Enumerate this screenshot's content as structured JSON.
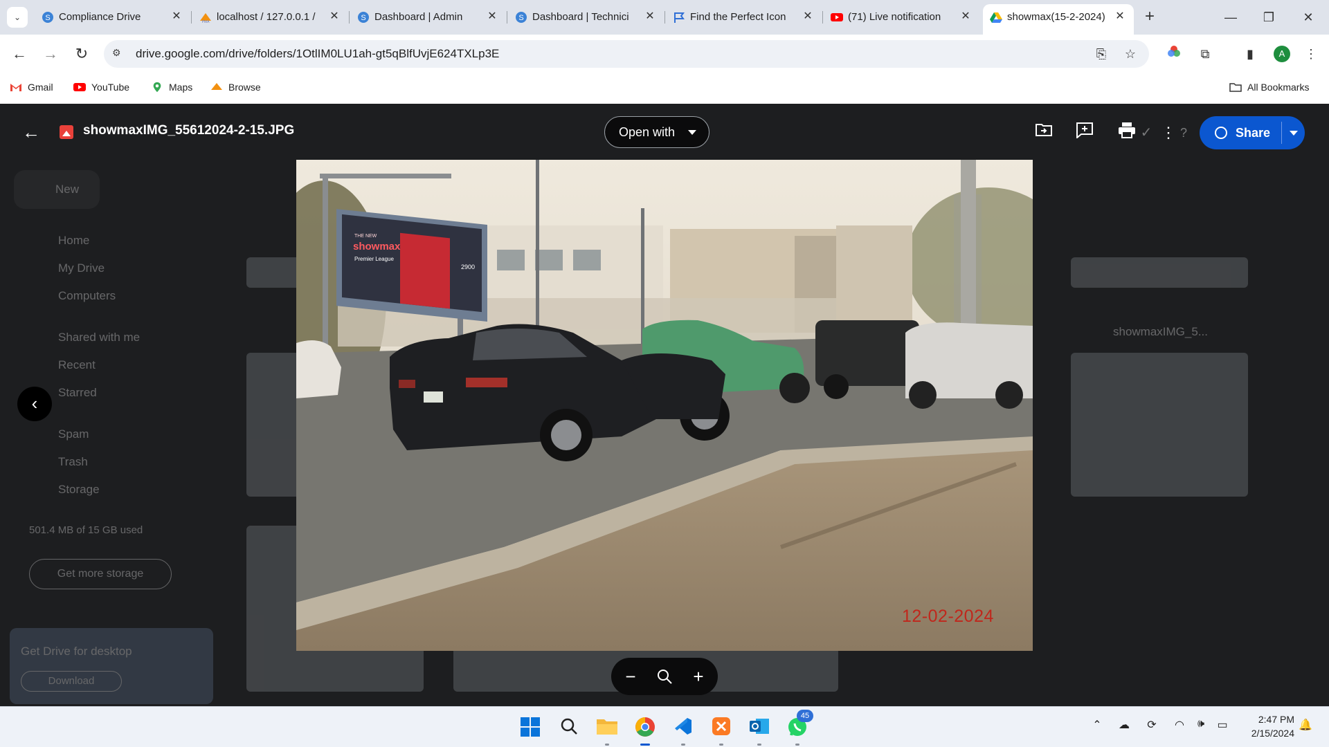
{
  "browser": {
    "tabs": [
      {
        "title": "Compliance Drive",
        "favicon": "blue-s-icon"
      },
      {
        "title": "localhost / 127.0.0.1 /",
        "favicon": "phpmyadmin-icon"
      },
      {
        "title": "Dashboard | Admin",
        "favicon": "blue-s-icon"
      },
      {
        "title": "Dashboard | Technici",
        "favicon": "blue-s-icon"
      },
      {
        "title": "Find the Perfect Icon",
        "favicon": "flag-icon"
      },
      {
        "title": "(71) Live notification",
        "favicon": "youtube-icon"
      },
      {
        "title": "showmax(15-2-2024)",
        "favicon": "google-drive-icon",
        "active": true
      }
    ],
    "url": "drive.google.com/drive/folders/1OtlIM0LU1ah-gt5qBlfUvjE624TXLp3E",
    "profile_initial": "A",
    "bookmarks": [
      {
        "label": "Gmail",
        "icon": "gmail-icon"
      },
      {
        "label": "YouTube",
        "icon": "youtube-icon"
      },
      {
        "label": "Maps",
        "icon": "maps-icon"
      },
      {
        "label": "Browse",
        "icon": "phpmyadmin-icon"
      }
    ],
    "all_bookmarks": "All Bookmarks"
  },
  "viewer": {
    "file_name": "showmaxIMG_55612024-2-15.JPG",
    "open_with": "Open with",
    "share": "Share",
    "photo_date_stamp": "12-02-2024",
    "billboard": {
      "line1": "THE NEW",
      "brand": "showmax",
      "line3": "Premier League",
      "price": "2900"
    }
  },
  "background_drive": {
    "new_button": "New",
    "nav": [
      "Home",
      "My Drive",
      "Computers",
      "Shared with me",
      "Recent",
      "Starred",
      "Spam",
      "Trash",
      "Storage"
    ],
    "storage": "501.4 MB of 15 GB used",
    "get_storage": "Get more storage",
    "banner_title": "Get Drive for desktop",
    "banner_button": "Download",
    "right_card_title": "showmaxIMG_5..."
  },
  "taskbar": {
    "whatsapp_badge": "45",
    "time": "2:47 PM",
    "date": "2/15/2024"
  },
  "colors": {
    "share_blue": "#0b57d0",
    "viewer_bg": "#1d1e20",
    "date_stamp_red": "#c0271c"
  }
}
